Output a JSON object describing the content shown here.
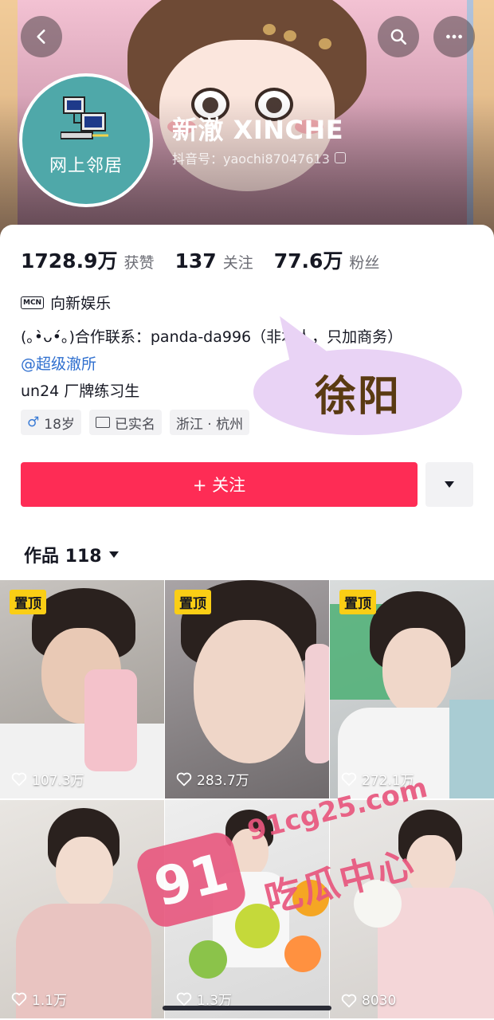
{
  "profile": {
    "name": "新澈 XINCHE",
    "douyin_id": "抖音号：yaochi87047613",
    "avatar_text": "网上邻居"
  },
  "stats": [
    {
      "value": "1728.9万",
      "label": "获赞"
    },
    {
      "value": "137",
      "label": "关注"
    },
    {
      "value": "77.6万",
      "label": "粉丝"
    }
  ],
  "bio": {
    "mcn_badge": "MCN",
    "mcn": "向新娱乐",
    "contact": "(｡•̀ᴗ•́｡)合作联系：panda-da996（非本人，只加商务）",
    "mention": "@超级澈所",
    "trainee": "un24 厂牌练习生"
  },
  "tags": [
    {
      "icon": "male-icon",
      "symbol": "♂",
      "text": "18岁"
    },
    {
      "icon": "id-card-icon",
      "text": "已实名"
    },
    {
      "text": "浙江 · 杭州"
    }
  ],
  "actions": {
    "follow_label": "+ 关注"
  },
  "works": {
    "label": "作品 118"
  },
  "overlay": {
    "bubble_text": "徐阳"
  },
  "videos": [
    {
      "pinned": "置顶",
      "likes": "107.3万"
    },
    {
      "pinned": "置顶",
      "likes": "283.7万"
    },
    {
      "pinned": "置顶",
      "likes": "272.1万"
    },
    {
      "pinned": "",
      "likes": "1.1万"
    },
    {
      "pinned": "",
      "likes": "1.3万"
    },
    {
      "pinned": "",
      "likes": "8030"
    }
  ],
  "watermark": {
    "badge": "91",
    "site": "91cg25.com",
    "name": "吃瓜中心"
  },
  "colors": {
    "accent": "#fe2c55",
    "link": "#2f6fcf",
    "pin_badge": "#face15",
    "watermark": "#e8577e"
  }
}
